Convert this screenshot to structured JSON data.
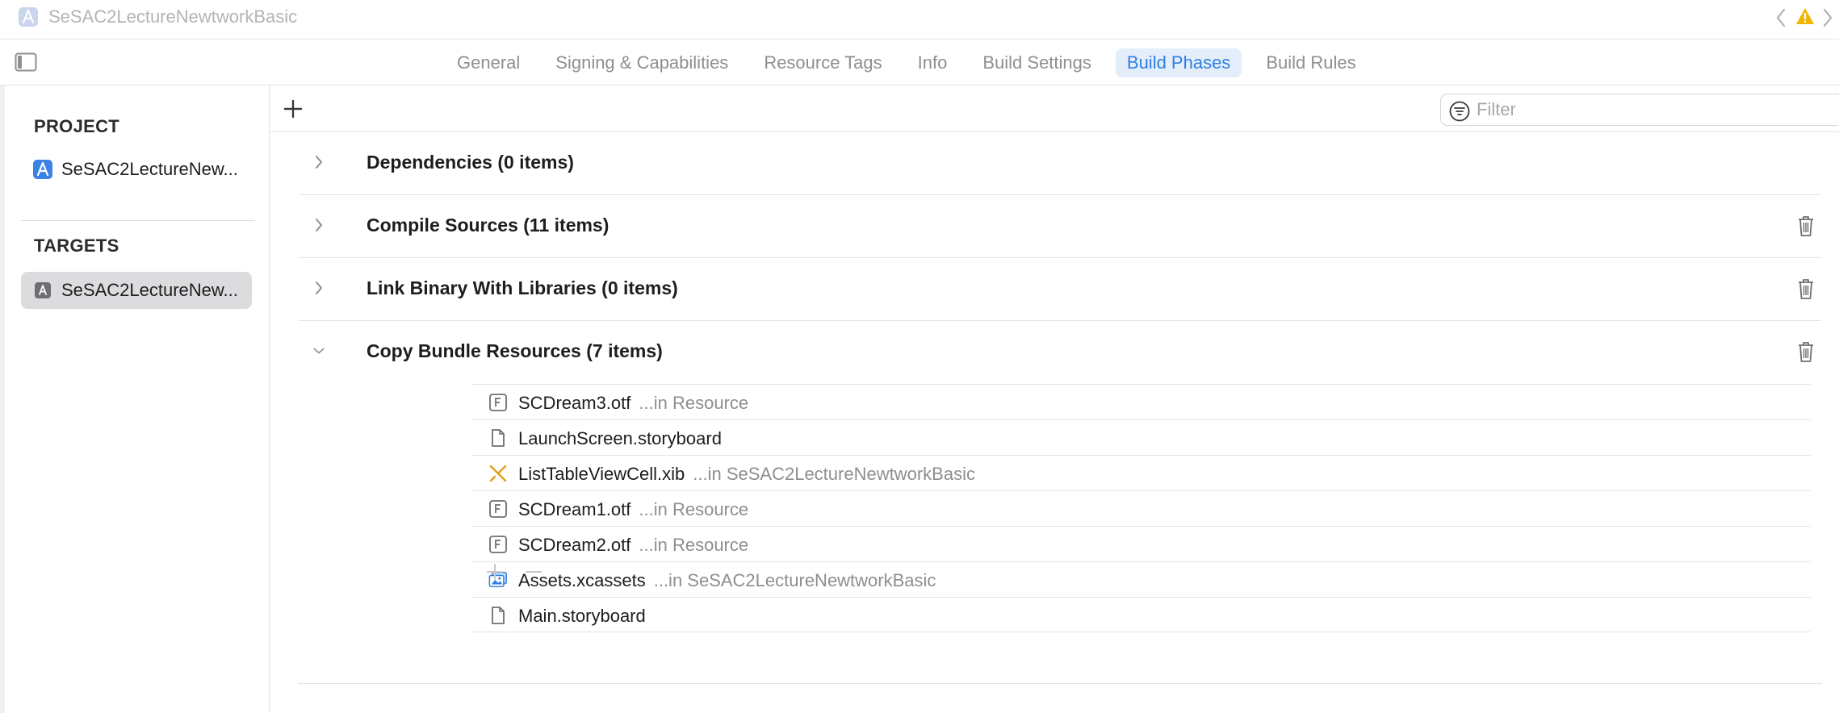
{
  "window": {
    "title": "SeSAC2LectureNewtworkBasic"
  },
  "tabs": [
    {
      "label": "General",
      "active": false
    },
    {
      "label": "Signing & Capabilities",
      "active": false
    },
    {
      "label": "Resource Tags",
      "active": false
    },
    {
      "label": "Info",
      "active": false
    },
    {
      "label": "Build Settings",
      "active": false
    },
    {
      "label": "Build Phases",
      "active": true
    },
    {
      "label": "Build Rules",
      "active": false
    }
  ],
  "sidebar": {
    "project_heading": "PROJECT",
    "project_item": "SeSAC2LectureNew...",
    "targets_heading": "TARGETS",
    "target_item": "SeSAC2LectureNew..."
  },
  "filter": {
    "placeholder": "Filter",
    "value": ""
  },
  "phases": [
    {
      "title": "Dependencies (0 items)",
      "expanded": false,
      "deletable": false
    },
    {
      "title": "Compile Sources (11 items)",
      "expanded": false,
      "deletable": true
    },
    {
      "title": "Link Binary With Libraries (0 items)",
      "expanded": false,
      "deletable": true
    },
    {
      "title": "Copy Bundle Resources (7 items)",
      "expanded": true,
      "deletable": true
    }
  ],
  "files": [
    {
      "name": "SCDream3.otf",
      "location": "...in Resource",
      "icon": "font-file-icon"
    },
    {
      "name": "LaunchScreen.storyboard",
      "location": "",
      "icon": "document-file-icon"
    },
    {
      "name": "ListTableViewCell.xib",
      "location": "...in SeSAC2LectureNewtworkBasic",
      "icon": "xib-file-icon"
    },
    {
      "name": "SCDream1.otf",
      "location": "...in Resource",
      "icon": "font-file-icon"
    },
    {
      "name": "SCDream2.otf",
      "location": "...in Resource",
      "icon": "font-file-icon"
    },
    {
      "name": "Assets.xcassets",
      "location": "...in SeSAC2LectureNewtworkBasic",
      "icon": "asset-catalog-icon"
    },
    {
      "name": "Main.storyboard",
      "location": "",
      "icon": "document-file-icon"
    }
  ],
  "colors": {
    "accent": "#2f7fe0",
    "active_tab_bg": "#e4eefb",
    "warning": "#f5b400",
    "xib_icon": "#e3a11c",
    "selected_row_bg": "#dcdcde"
  }
}
